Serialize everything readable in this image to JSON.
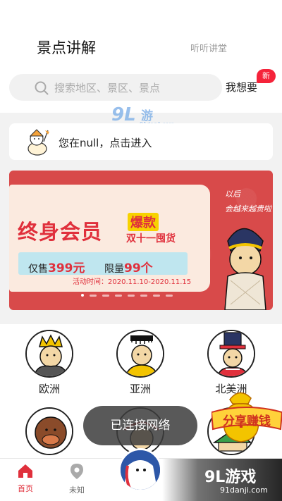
{
  "header": {
    "tab_active": "景点讲解",
    "tab_inactive": "听听讲堂"
  },
  "search": {
    "placeholder": "搜索地区、景区、景点",
    "want_label": "我想要",
    "badge": "新"
  },
  "location": {
    "text": "您在null，点击进入"
  },
  "banner": {
    "headline": "终身会员",
    "hot": "爆款",
    "sale": "双十一囤货",
    "price_prefix": "仅售",
    "price": "399元",
    "limit_prefix": "限量",
    "limit": "99个",
    "date": "活动时间：2020.11.10-2020.11.15",
    "right_line1": "以后",
    "right_line2": "会越来越贵啦",
    "active_dot": 0,
    "dot_count": 8
  },
  "regions": [
    {
      "label": "欧洲"
    },
    {
      "label": "亚洲"
    },
    {
      "label": "北美洲"
    }
  ],
  "share_label": "分享赚钱",
  "toast": "已连接网络",
  "bottom_nav": {
    "home": "首页",
    "unknown": "未知"
  },
  "watermark": {
    "main": "9L游戏",
    "sub": "91danji.com",
    "top_logo": "9L",
    "top_text": "游戏",
    "top_sub": "91danji.com"
  },
  "colors": {
    "accent": "#e0303c",
    "badge": "#f5233a",
    "banner_bg": "#d84a4a"
  }
}
